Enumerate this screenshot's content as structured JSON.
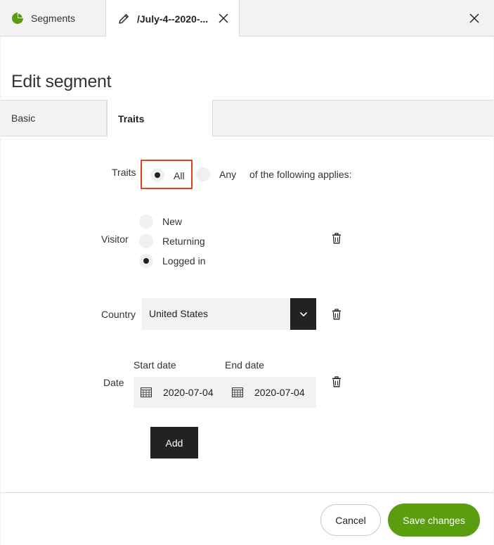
{
  "tabs": {
    "segments_label": "Segments",
    "edit_label": "/July-4--2020-..."
  },
  "page": {
    "title": "Edit segment"
  },
  "subtabs": {
    "basic": "Basic",
    "traits": "Traits"
  },
  "traits": {
    "label": "Traits",
    "all": "All",
    "any": "Any",
    "suffix": "of the following applies:",
    "selected": "All"
  },
  "visitor": {
    "label": "Visitor",
    "options": [
      "New",
      "Returning",
      "Logged in"
    ],
    "selected": "Logged in"
  },
  "country": {
    "label": "Country",
    "value": "United States"
  },
  "date": {
    "label": "Date",
    "start_label": "Start date",
    "end_label": "End date",
    "start_value": "2020-07-04",
    "end_value": "2020-07-04"
  },
  "buttons": {
    "add": "Add",
    "cancel": "Cancel",
    "save": "Save changes"
  },
  "colors": {
    "accent": "#5a9e10",
    "highlight": "#e8401c",
    "dark": "#222222"
  },
  "icons": {
    "segments_tab": "pie-chart-icon",
    "edit_tab": "pencil-icon",
    "close": "close-icon",
    "delete": "trash-icon",
    "calendar": "calendar-icon",
    "dropdown": "chevron-down-icon"
  }
}
